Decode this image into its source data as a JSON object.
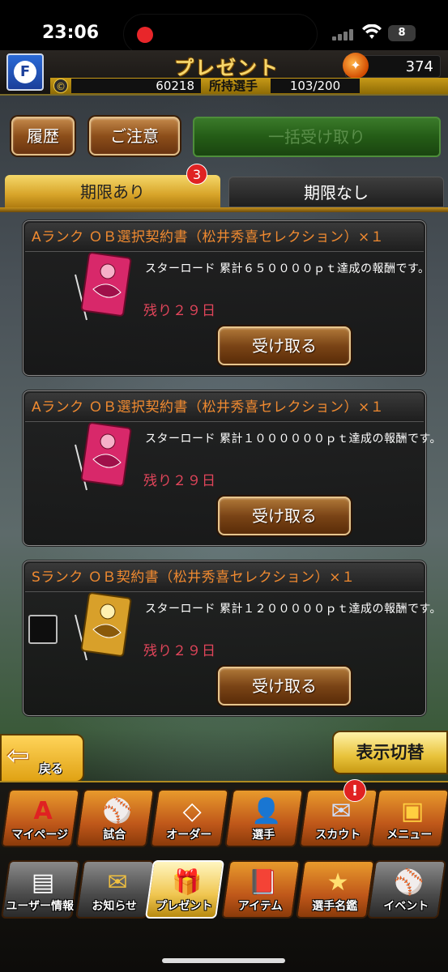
{
  "status_bar": {
    "time": "23:06",
    "battery": "8"
  },
  "header": {
    "title": "プレゼント",
    "logo_letter": "F",
    "coin_value": "374",
    "points": "60218",
    "owned_label": "所持選手",
    "owned_value": "103/200"
  },
  "toolbar": {
    "history_label": "履歴",
    "notice_label": "ご注意",
    "bulk_receive_label": "一括受け取り"
  },
  "tabs": [
    {
      "label": "期限あり",
      "badge": "3"
    },
    {
      "label": "期限なし"
    }
  ],
  "presents": [
    {
      "title": "Aランク ＯＢ選択契約書（松井秀喜セレクション）×１",
      "description": "スターロード 累計６５００００ｐｔ達成の報酬です。",
      "remaining": "残り２９日",
      "receive_label": "受け取る",
      "rank_color": "#d8286a"
    },
    {
      "title": "Aランク ＯＢ選択契約書（松井秀喜セレクション）×１",
      "description": "スターロード 累計１００００００ｐｔ達成の報酬です。",
      "remaining": "残り２９日",
      "receive_label": "受け取る",
      "rank_color": "#d8286a"
    },
    {
      "title": "Sランク ＯＢ契約書（松井秀喜セレクション）×１",
      "description": "スターロード 累計１２０００００ｐｔ達成の報酬です。",
      "remaining": "残り２９日",
      "receive_label": "受け取る",
      "rank_color": "#d8a02a"
    }
  ],
  "bottom": {
    "back_label": "戻る",
    "toggle_label": "表示切替"
  },
  "nav_row1": [
    {
      "label": "マイページ",
      "icon": "mypage-icon",
      "glyph": "A"
    },
    {
      "label": "試合",
      "icon": "game-icon",
      "glyph": "⚾"
    },
    {
      "label": "オーダー",
      "icon": "order-icon",
      "glyph": "◇"
    },
    {
      "label": "選手",
      "icon": "player-icon",
      "glyph": "👤"
    },
    {
      "label": "スカウト",
      "icon": "scout-icon",
      "glyph": "✉",
      "badge": "!"
    },
    {
      "label": "メニュー",
      "icon": "menu-icon",
      "glyph": "▣"
    }
  ],
  "nav_row2": [
    {
      "label": "ユーザー情報",
      "icon": "user-info-icon",
      "glyph": "▤"
    },
    {
      "label": "お知らせ",
      "icon": "notice-icon",
      "glyph": "✉"
    },
    {
      "label": "プレゼント",
      "icon": "present-icon",
      "glyph": "🎁"
    },
    {
      "label": "アイテム",
      "icon": "item-icon",
      "glyph": "📕"
    },
    {
      "label": "選手名鑑",
      "icon": "player-directory-icon",
      "glyph": "★"
    },
    {
      "label": "イベント",
      "icon": "event-icon",
      "glyph": "⚾"
    }
  ]
}
